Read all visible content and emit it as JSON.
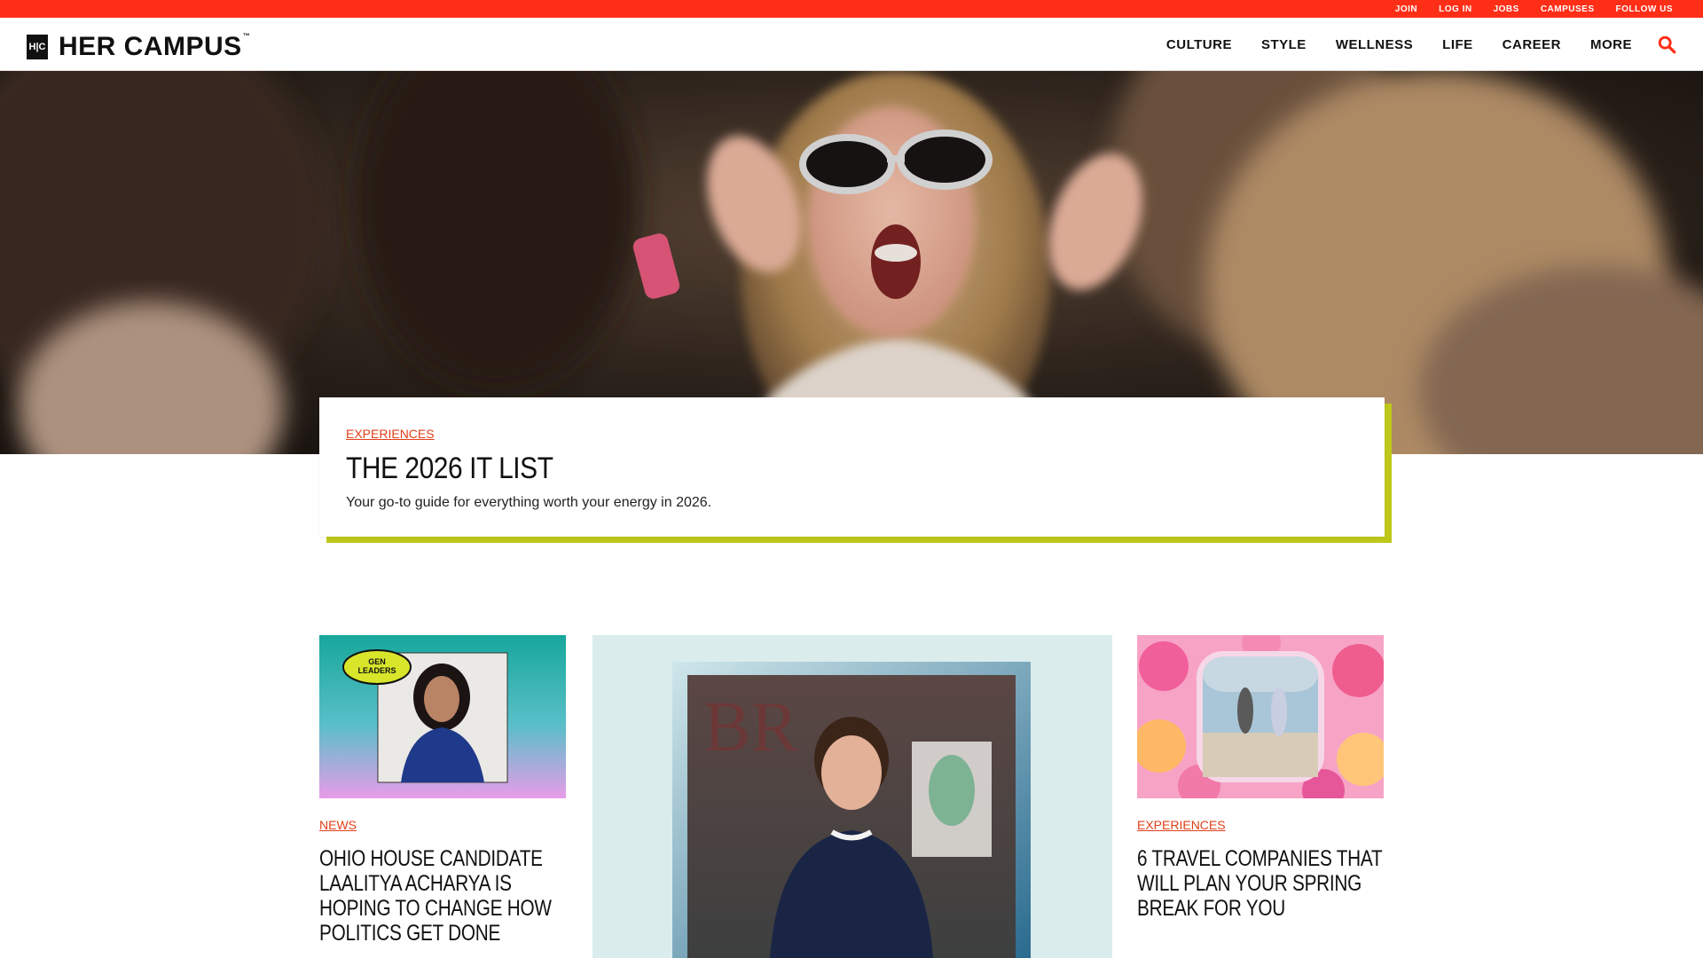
{
  "utility_nav": [
    "JOIN",
    "LOG IN",
    "JOBS",
    "CAMPUSES",
    "FOLLOW US"
  ],
  "header": {
    "logo_mark": "H|C",
    "logo_text": "HER CAMPUS",
    "logo_tm": "™",
    "nav": [
      "CULTURE",
      "STYLE",
      "WELLNESS",
      "LIFE",
      "CAREER",
      "MORE"
    ],
    "search_icon": "search-icon"
  },
  "feature": {
    "category": "EXPERIENCES",
    "title": "THE 2026 IT LIST",
    "dek": "Your go-to guide for everything worth your energy in 2026."
  },
  "articles": [
    {
      "category": "NEWS",
      "headline": "OHIO HOUSE CANDIDATE LAALITYA ACHARYA IS HOPING TO CHANGE HOW POLITICS GET DONE",
      "badge": "GEN LEADERS"
    },
    {
      "category": "",
      "headline": ""
    },
    {
      "category": "EXPERIENCES",
      "headline": "6 TRAVEL COMPANIES THAT WILL PLAN YOUR SPRING BREAK FOR YOU"
    }
  ],
  "colors": {
    "brand_red": "#ff2e17",
    "category_orange": "#e2401a",
    "accent_lime": "#bfc81a",
    "text": "#111111"
  }
}
